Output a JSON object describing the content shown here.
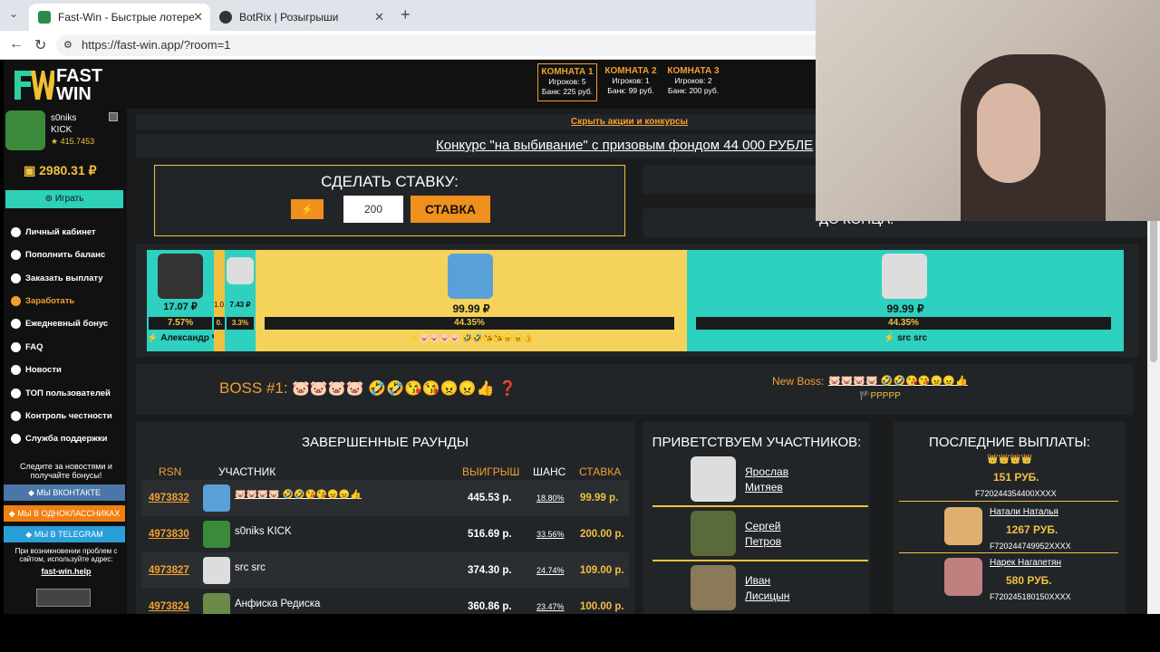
{
  "browser": {
    "tabs": [
      {
        "title": "Fast-Win - Быстрые лотереи! Ком"
      },
      {
        "title": "BotRix | Розыгрыши"
      }
    ],
    "url": "https://fast-win.app/?room=1"
  },
  "logo": {
    "line1": "FAST",
    "line2": "WIN"
  },
  "rooms": [
    {
      "title": "КОМНАТА 1",
      "players": "Игроков: 5",
      "bank": "Банк: 225 руб."
    },
    {
      "title": "КОМНАТА 2",
      "players": "Игроков: 1",
      "bank": "Банк: 99 руб."
    },
    {
      "title": "КОМНАТА 3",
      "players": "Игроков: 2",
      "bank": "Банк: 200 руб."
    }
  ],
  "user": {
    "name": "s0niks",
    "sub": "KICK",
    "rating": "★ 415.7453",
    "balance": "2980.31 ₽",
    "play": "Играть"
  },
  "menu": [
    "Личный кабинет",
    "Пополнить баланс",
    "Заказать выплату",
    "Заработать",
    "Ежедневный бонус",
    "FAQ",
    "Новости",
    "ТОП пользователей",
    "Контроль честности",
    "Служба поддержки"
  ],
  "social": {
    "text": "Следите за новостями и получайте бонусы!",
    "vk": "МЫ ВКОНТАКТЕ",
    "ok": "МЫ В ОДНОКЛАССНИКАХ",
    "tg": "МЫ В TELEGRAM",
    "help": "При возникновении проблем с сайтом, используйте адрес:",
    "helpurl": "fast-win.help"
  },
  "promo": {
    "hide": "Скрыть акции и конкурсы",
    "contest": "Конкурс \"на выбивание\" с призовым фондом 44 000 РУБЛЕ"
  },
  "bet": {
    "title": "СДЕЛАТЬ СТАВКУ:",
    "value": "200",
    "button": "СТАВКА"
  },
  "timer": {
    "label": "ДО КОНЦА:"
  },
  "players": [
    {
      "amount": "17.07 ₽",
      "pct": "7.57%",
      "name": "⚡ Александр Че"
    },
    {
      "amount": "1.0",
      "pct": "0."
    },
    {
      "amount": "7.43 ₽",
      "pct": "3.3%"
    },
    {
      "amount": "99.99 ₽",
      "pct": "44.35%",
      "name": "⚡🐷🐷🐷🐷 🤣🤣😘😘😠😠👍"
    },
    {
      "amount": "99.99 ₽",
      "pct": "44.35%",
      "name": "⚡ src src"
    }
  ],
  "boss": {
    "label": "BOSS #1:",
    "emojis": "🐷🐷🐷🐷 🤣🤣😘😘😠😠👍 ❓",
    "new_label": "New Boss:",
    "new_emojis": "🐷🐷🐷🐷 🤣🤣😘😘😠😠👍",
    "new_sub": "🏴PPPPP"
  },
  "rounds": {
    "title": "ЗАВЕРШЕННЫЕ РАУНДЫ",
    "headers": [
      "RSN",
      "УЧАСТНИК",
      "ВЫИГРЫШ",
      "ШАНС",
      "СТАВКА"
    ],
    "rows": [
      {
        "rsn": "4973832",
        "name": "🐷🐷🐷🐷 🤣🤣😘😘😠😠👍",
        "win": "445.53 р.",
        "chance": "18.80%",
        "bet": "99.99 р."
      },
      {
        "rsn": "4973830",
        "name": "s0niks KICK",
        "win": "516.69 р.",
        "chance": "33.56%",
        "bet": "200.00 р."
      },
      {
        "rsn": "4973827",
        "name": "src src",
        "win": "374.30 р.",
        "chance": "24.74%",
        "bet": "109.00 р."
      },
      {
        "rsn": "4973824",
        "name": "Анфиска Редиска",
        "win": "360.86 р.",
        "chance": "23.47%",
        "bet": "100.00 р."
      }
    ]
  },
  "welcome": {
    "title": "ПРИВЕТСТВУЕМ УЧАСТНИКОВ:",
    "users": [
      {
        "first": "Ярослав",
        "last": "Митяев"
      },
      {
        "first": "Сергей",
        "last": "Петров"
      },
      {
        "first": "Иван",
        "last": "Лисицын"
      }
    ]
  },
  "payouts": {
    "title": "ПОСЛЕДНИЕ ВЫПЛАТЫ:",
    "crowns": "👑👑👑👑",
    "items": [
      {
        "name": "",
        "amount": "151 РУБ.",
        "wallet": "F720244354400XXXX"
      },
      {
        "name": "Натали Наталья",
        "amount": "1267 РУБ.",
        "wallet": "F720244749952XXXX"
      },
      {
        "name": "Нарек Нагапетян",
        "amount": "580 РУБ.",
        "wallet": "F720245180150XXXX"
      }
    ]
  }
}
